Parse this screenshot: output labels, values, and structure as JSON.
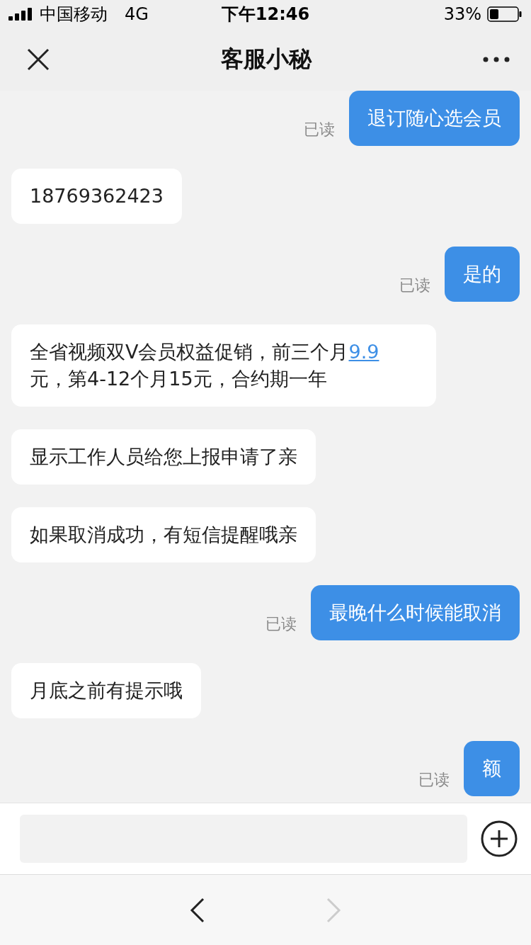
{
  "status_bar": {
    "carrier": "中国移动",
    "network": "4G",
    "time": "下午12:46",
    "battery": "33%"
  },
  "header": {
    "title": "客服小秘"
  },
  "messages": [
    {
      "kind": "sent",
      "read_label": "已读",
      "parts": [
        {
          "kind": "text",
          "text": "退订随心选会员"
        }
      ]
    },
    {
      "kind": "received",
      "parts": [
        {
          "kind": "text",
          "text": "18769362423"
        }
      ]
    },
    {
      "kind": "sent",
      "read_label": "已读",
      "parts": [
        {
          "kind": "text",
          "text": "是的"
        }
      ]
    },
    {
      "kind": "received",
      "parts": [
        {
          "kind": "text",
          "text": "全省视频双V会员权益促销，前三个月"
        },
        {
          "kind": "link",
          "text": "9.9"
        },
        {
          "kind": "text",
          "text": " 元，第4-12个月15元，合约期一年"
        }
      ]
    },
    {
      "kind": "received",
      "parts": [
        {
          "kind": "text",
          "text": "显示工作人员给您上报申请了亲"
        }
      ]
    },
    {
      "kind": "received",
      "parts": [
        {
          "kind": "text",
          "text": "如果取消成功，有短信提醒哦亲"
        }
      ]
    },
    {
      "kind": "sent",
      "read_label": "已读",
      "parts": [
        {
          "kind": "text",
          "text": "最晚什么时候能取消"
        }
      ]
    },
    {
      "kind": "received",
      "parts": [
        {
          "kind": "text",
          "text": "月底之前有提示哦"
        }
      ]
    },
    {
      "kind": "sent",
      "read_label": "已读",
      "parts": [
        {
          "kind": "text",
          "text": "额"
        }
      ]
    }
  ],
  "nav": {
    "back_disabled": false,
    "forward_disabled": true
  }
}
